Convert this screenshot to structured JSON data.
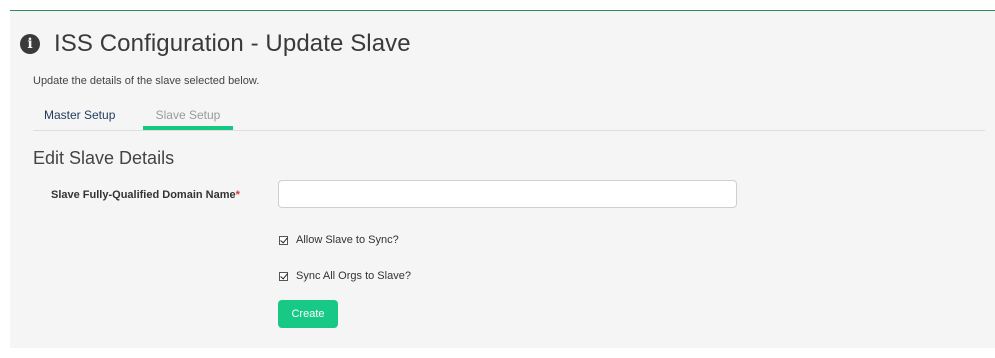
{
  "header": {
    "title": "ISS Configuration - Update Slave",
    "subtitle": "Update the details of the slave selected below.",
    "icon": "info-circle-icon"
  },
  "tabs": [
    {
      "label": "Master Setup",
      "active": false
    },
    {
      "label": "Slave Setup",
      "active": true
    }
  ],
  "form": {
    "section_title": "Edit Slave Details",
    "fqdn": {
      "label": "Slave Fully-Qualified Domain Name",
      "required_marker": "*",
      "value": "",
      "placeholder": ""
    },
    "allow_sync": {
      "label": "Allow Slave to Sync?",
      "checked": true
    },
    "sync_all_orgs": {
      "label": "Sync All Orgs to Slave?",
      "checked": true
    },
    "submit_label": "Create"
  },
  "colors": {
    "accent": "#17c985",
    "top_rule": "#2e8b57",
    "required": "#d9363e",
    "tab_active_text": "#1f3a5c"
  }
}
